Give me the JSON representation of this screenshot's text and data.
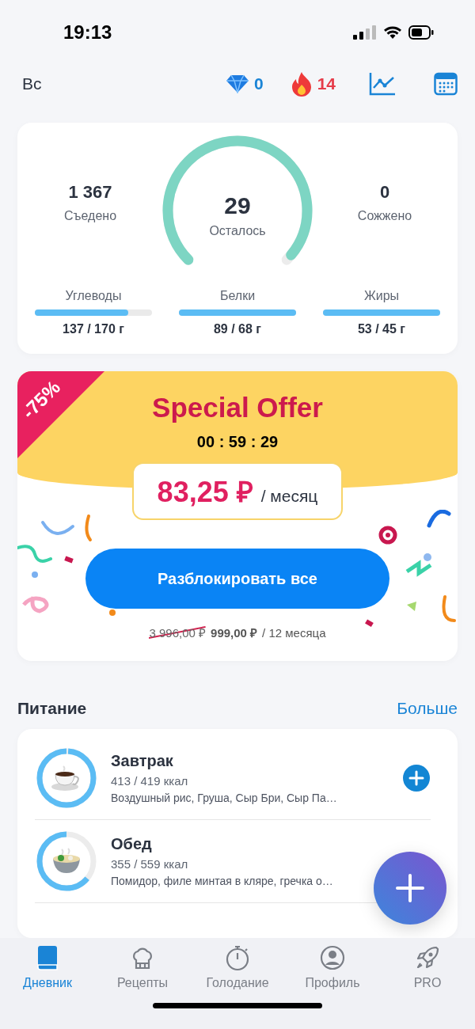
{
  "status_bar": {
    "time": "19:13"
  },
  "header": {
    "day": "Вс",
    "gems": "0",
    "streak": "14"
  },
  "summary": {
    "eaten": {
      "value": "1 367",
      "label": "Съедено"
    },
    "remaining": {
      "value": "29",
      "label": "Осталось"
    },
    "burned": {
      "value": "0",
      "label": "Сожжено"
    },
    "macros": [
      {
        "name": "Углеводы",
        "level": 0.8,
        "reading": "137 / 170 г"
      },
      {
        "name": "Белки",
        "level": 1,
        "reading": "89 / 68 г"
      },
      {
        "name": "Жиры",
        "level": 1,
        "reading": "53 / 45 г"
      }
    ]
  },
  "offer": {
    "discount": "-75%",
    "title": "Special Offer",
    "timer": "00 : 59 : 29",
    "price": "83,25 ₽",
    "period": "/ месяц",
    "button": "Разблокировать все",
    "old_price": "3 996,00 ₽",
    "new_price": "999,00 ₽",
    "term": "/ 12 месяца"
  },
  "nutrition": {
    "title": "Питание",
    "more": "Больше",
    "meals": [
      {
        "kind": "cup",
        "name": "Завтрак",
        "kcal": "413 / 419 ккал",
        "foods": "Воздушный рис, Груша, Сыр Бри, Сыр Па…",
        "add_button": true
      },
      {
        "kind": "bowl",
        "name": "Обед",
        "kcal": "355 / 559 ккал",
        "foods": "Помидор, филе минтая в кляре, гречка о…",
        "add_button": false
      }
    ]
  },
  "tabs": [
    {
      "kind": "book",
      "label": "Дневник",
      "selected": true
    },
    {
      "kind": "chef",
      "label": "Рецепты",
      "selected": false
    },
    {
      "kind": "timer",
      "label": "Голодание",
      "selected": false
    },
    {
      "kind": "profile",
      "label": "Профиль",
      "selected": false
    },
    {
      "kind": "rocket",
      "label": "PRO",
      "selected": false
    }
  ]
}
